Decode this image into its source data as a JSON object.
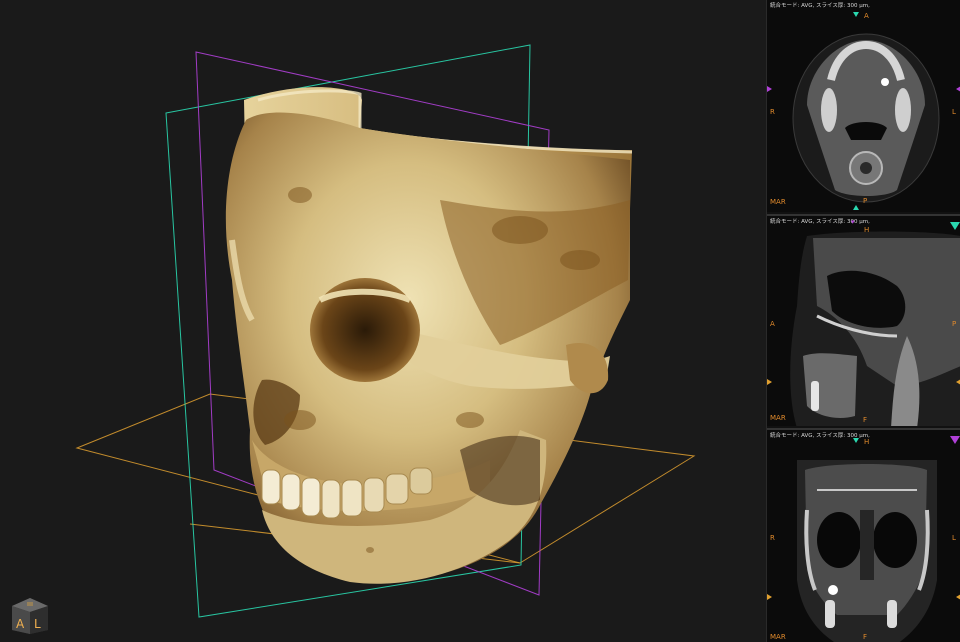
{
  "viewer": {
    "cube_labels": {
      "left": "A",
      "right": "L"
    },
    "colors": {
      "axial_plane": "#e0a030",
      "coronal_plane": "#2ad8b0",
      "sagittal_plane": "#b040d8",
      "annotation": "#e08a2c",
      "bone": "#d6c28a",
      "background": "#1a1a1a"
    }
  },
  "panels": {
    "axial": {
      "header": "統合モード: AVG, スライス厚: 300 μm,",
      "top": "A",
      "bottom": "P",
      "left": "R",
      "right": "L",
      "mar": "MAR"
    },
    "sagittal": {
      "header": "統合モード: AVG, スライス厚: 300 μm,",
      "top": "H",
      "bottom": "F",
      "left": "A",
      "right": "P",
      "mar": "MAR"
    },
    "coronal": {
      "header": "統合モード: AVG, スライス厚: 300 μm,",
      "top": "H",
      "bottom": "F",
      "left": "R",
      "right": "L",
      "mar": "MAR"
    }
  }
}
